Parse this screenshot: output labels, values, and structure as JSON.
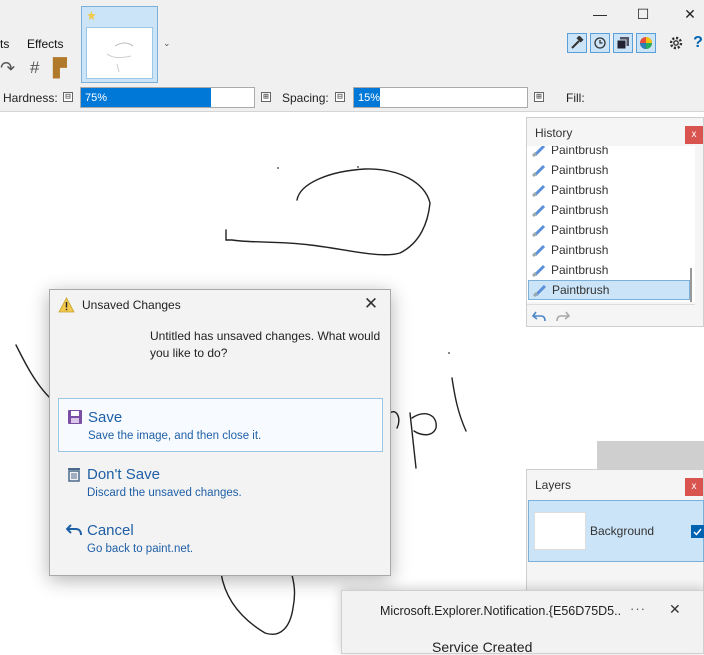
{
  "menu": {
    "partial_item": "ts",
    "effects": "Effects"
  },
  "toolbar": {
    "options": {
      "hardness_label": "Hardness:",
      "hardness_value": "75%",
      "hardness_fraction": 0.75,
      "spacing_label": "Spacing:",
      "spacing_value": "15%",
      "spacing_fraction": 0.15,
      "fill_label": "Fill:",
      "minus": "⊟",
      "plus": "⊞"
    },
    "window_buttons": {
      "minimize": "—",
      "maximize": "☐",
      "close": "✕"
    },
    "panel_toggles": [
      "tools-icon",
      "history-icon",
      "layers-icon",
      "colors-icon"
    ],
    "settings_icon": "gear-icon",
    "help_icon": "?"
  },
  "history": {
    "title": "History",
    "close": "x",
    "items": [
      "Paintbrush",
      "Paintbrush",
      "Paintbrush",
      "Paintbrush",
      "Paintbrush",
      "Paintbrush",
      "Paintbrush",
      "Paintbrush"
    ],
    "selected_index": 7
  },
  "layers": {
    "title": "Layers",
    "close": "x",
    "items": [
      {
        "name": "Background",
        "visible": true
      }
    ]
  },
  "dialog": {
    "title": "Unsaved Changes",
    "close": "✕",
    "message": "Untitled has unsaved changes. What would you like to do?",
    "options": [
      {
        "label": "Save",
        "description": "Save the image, and then close it."
      },
      {
        "label": "Don't Save",
        "description": "Discard the unsaved changes."
      },
      {
        "label": "Cancel",
        "description": "Go back to paint.net."
      }
    ]
  },
  "toast": {
    "title": "Microsoft.Explorer.Notification.{E56D75D5...",
    "more": "···",
    "close": "✕",
    "body": "Service Created"
  },
  "colors": {
    "accent": "#0078d7",
    "link": "#1f5fa6",
    "panel_close": "#d9534f",
    "selection": "#cce4f7"
  }
}
